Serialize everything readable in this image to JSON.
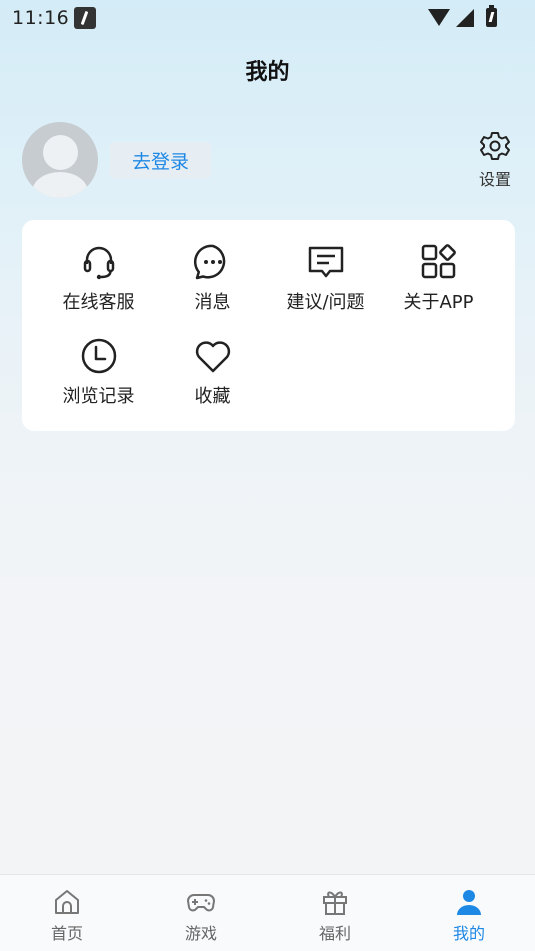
{
  "status_bar": {
    "time": "11:16"
  },
  "header": {
    "title": "我的"
  },
  "profile": {
    "login_label": "去登录",
    "settings_label": "设置"
  },
  "menu": {
    "items": [
      {
        "label": "在线客服",
        "icon": "headset-icon"
      },
      {
        "label": "消息",
        "icon": "message-icon"
      },
      {
        "label": "建议/问题",
        "icon": "feedback-icon"
      },
      {
        "label": "关于APP",
        "icon": "apps-icon"
      },
      {
        "label": "浏览记录",
        "icon": "clock-icon"
      },
      {
        "label": "收藏",
        "icon": "heart-icon"
      }
    ]
  },
  "bottom_nav": {
    "items": [
      {
        "label": "首页",
        "icon": "home-icon"
      },
      {
        "label": "游戏",
        "icon": "gamepad-icon"
      },
      {
        "label": "福利",
        "icon": "gift-icon"
      },
      {
        "label": "我的",
        "icon": "user-icon",
        "active": true
      }
    ]
  },
  "colors": {
    "accent": "#1e88e5",
    "inactive": "#666666",
    "card": "#ffffff"
  }
}
